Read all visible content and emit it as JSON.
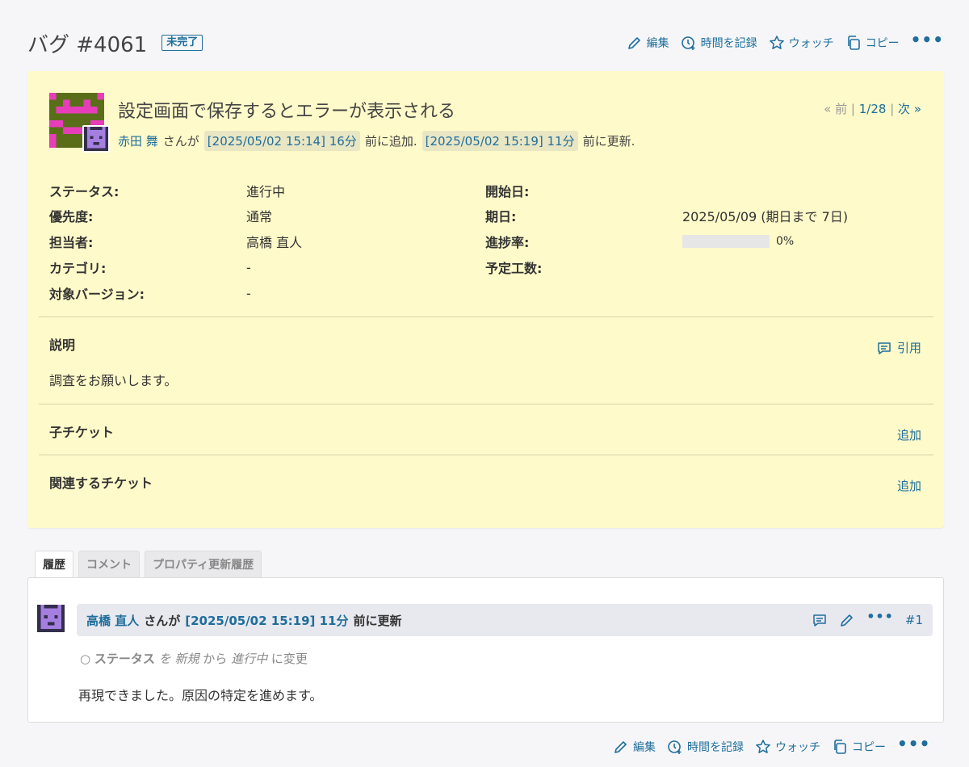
{
  "header": {
    "title": "バグ #4061",
    "status": "未完了",
    "actions": {
      "edit": "編集",
      "log_time": "時間を記録",
      "watch": "ウォッチ",
      "copy": "コピー",
      "more": "•••"
    }
  },
  "issue": {
    "subject": "設定画面で保存するとエラーが表示される",
    "author": "赤田 舞",
    "by_text": "さんが",
    "created_time": "[2025/05/02 15:14] 16分",
    "created_suffix": "前に追加.",
    "updated_time": "[2025/05/02 15:19] 11分",
    "updated_suffix": "前に更新.",
    "nav": {
      "prev": "« 前",
      "sep1": "|",
      "position": "1/28",
      "sep2": "|",
      "next": "次 »"
    }
  },
  "attributes": {
    "status_label": "ステータス:",
    "status": "進行中",
    "priority_label": "優先度:",
    "priority": "通常",
    "assignee_label": "担当者:",
    "assignee": "高橋 直人",
    "category_label": "カテゴリ:",
    "category": "-",
    "version_label": "対象バージョン:",
    "version": "-",
    "start_label": "開始日:",
    "start": "",
    "due_label": "期日:",
    "due": "2025/05/09 (期日まで 7日)",
    "progress_label": "進捗率:",
    "progress": 0,
    "progress_text": "0%",
    "estimated_label": "予定工数:",
    "estimated": ""
  },
  "description": {
    "title": "説明",
    "quote": "引用",
    "text": "調査をお願いします。"
  },
  "subtasks": {
    "title": "子チケット",
    "add": "追加"
  },
  "relations": {
    "title": "関連するチケット",
    "add": "追加"
  },
  "tabs": [
    "履歴",
    "コメント",
    "プロパティ更新履歴"
  ],
  "journal": {
    "user": "高橋 直人",
    "by_text": "さんが",
    "time": "[2025/05/02 15:19] 11分",
    "suffix": "前に更新",
    "number": "#1",
    "detail_field": "ステータス",
    "detail_wo": "を",
    "detail_old": "新規",
    "detail_kara": "から",
    "detail_new": "進行中",
    "detail_end": "に変更",
    "note": "再現できました。原因の特定を進めます。"
  },
  "colors": {
    "accent": "#1f6e9c",
    "issue_bg": "#fffac9"
  }
}
